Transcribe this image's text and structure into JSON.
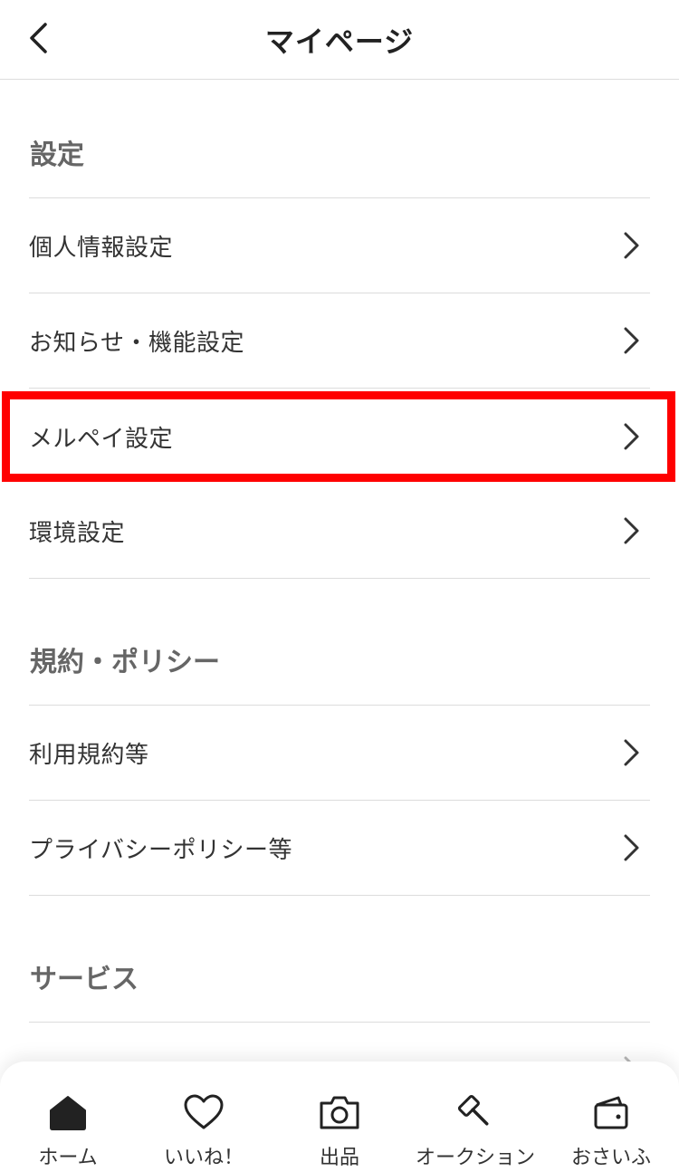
{
  "header": {
    "title": "マイページ"
  },
  "sections": [
    {
      "title": "設定",
      "items": [
        {
          "label": "個人情報設定"
        },
        {
          "label": "お知らせ・機能設定"
        },
        {
          "label": "メルペイ設定"
        },
        {
          "label": "環境設定"
        }
      ]
    },
    {
      "title": "規約・ポリシー",
      "items": [
        {
          "label": "利用規約等"
        },
        {
          "label": "プライバシーポリシー等"
        }
      ]
    },
    {
      "title": "サービス",
      "items": []
    }
  ],
  "highlight": {
    "color": "#ff0000",
    "target": "メルペイ設定"
  },
  "bottom_nav": [
    {
      "label": "ホーム",
      "icon": "home-icon",
      "active": true
    },
    {
      "label": "いいね！",
      "icon": "heart-icon"
    },
    {
      "label": "出品",
      "icon": "camera-icon"
    },
    {
      "label": "オークション",
      "icon": "gavel-icon"
    },
    {
      "label": "おさいふ",
      "icon": "wallet-icon"
    }
  ]
}
